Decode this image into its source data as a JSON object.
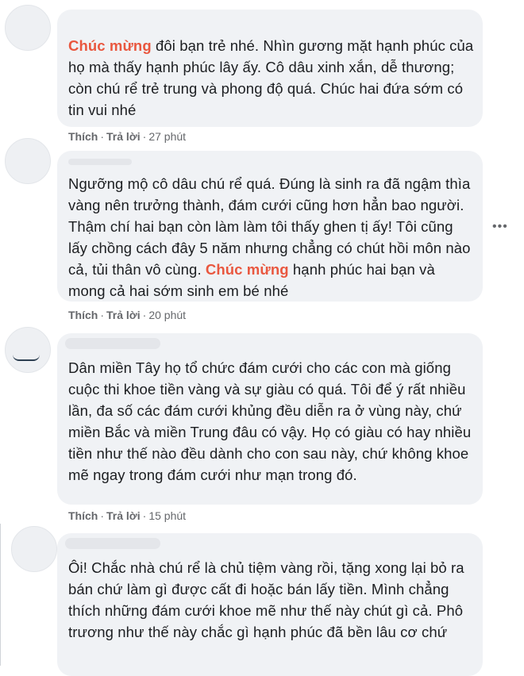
{
  "comments": [
    {
      "highlight": "Chúc mừng",
      "text_rest": " đôi bạn trẻ nhé. Nhìn gương mặt hạnh phúc của họ mà thấy hạnh phúc lây ấy. Cô dâu xinh xắn, dễ thương; còn chú rể trẻ trung và phong độ quá. Chúc hai đứa sớm có tin vui nhé",
      "like_label": "Thích",
      "reply_label": "Trả lời",
      "time": "27 phút"
    },
    {
      "text_before": "Ngưỡng mộ cô dâu chú rể quá. Đúng là sinh ra đã ngậm thìa vàng nên trưởng thành, đám cưới cũng hơn hẳn bao người. Thậm chí hai bạn còn làm làm tôi thấy ghen tị ấy! Tôi cũng lấy chồng cách đây 5 năm nhưng chẳng có chút hồi môn nào cả, tủi thân vô cùng. ",
      "highlight": "Chúc mừng",
      "text_after": " hạnh phúc hai bạn và mong cả hai sớm sinh em bé nhé",
      "like_label": "Thích",
      "reply_label": "Trả lời",
      "time": "20 phút"
    },
    {
      "text": "Dân miền Tây họ tổ chức đám cưới cho các con mà giống cuộc thi khoe tiền vàng và sự giàu có quá. Tôi để ý rất nhiều lần, đa số các đám cưới khủng đều diễn ra ở vùng này, chứ miền Bắc và miền Trung đâu có vậy. Họ có giàu có hay nhiều tiền như thế nào đều dành cho con sau này, chứ không khoe mẽ ngay trong đám cưới như mạn trong đó.",
      "like_label": "Thích",
      "reply_label": "Trả lời",
      "time": "15 phút"
    },
    {
      "text": "Ôi! Chắc nhà chú rể là chủ tiệm vàng rồi, tặng xong lại bỏ ra bán chứ làm gì được cất đi hoặc bán lấy tiền. Mình chẳng thích những đám cưới khoe mẽ như thế này chút gì cả. Phô trương như thế này chắc gì hạnh phúc đã bền lâu cơ chứ"
    }
  ],
  "more_label": "•••",
  "colors": {
    "bubble": "#f0f2f5",
    "highlight": "#e9573f",
    "meta": "#65676b"
  }
}
